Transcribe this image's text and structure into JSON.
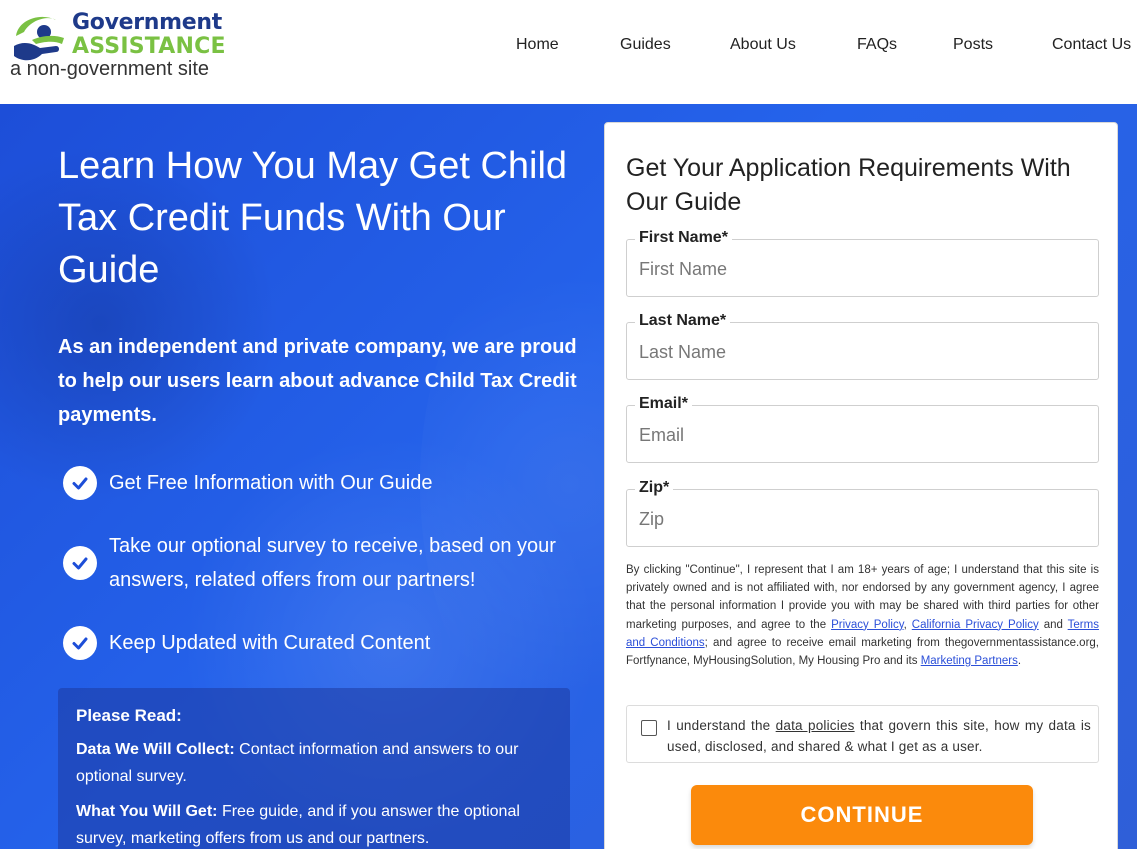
{
  "brand": {
    "line1": "Government",
    "line2": "ASSISTANCE",
    "tagline": "a non-government site",
    "colors": {
      "navy": "#1e3a8a",
      "green": "#7ac143"
    }
  },
  "nav": [
    "Home",
    "Guides",
    "About Us",
    "FAQs",
    "Posts",
    "Contact Us"
  ],
  "hero": {
    "title": "Learn How You May Get Child Tax Credit Funds With Our Guide",
    "subtitle": "As an independent and private company, we are proud to help our users learn about advance Child Tax Credit payments.",
    "features": [
      "Get Free Information with Our Guide",
      "Take our optional survey to receive, based on your answers, related offers from our partners!",
      "Keep Updated with Curated Content"
    ],
    "notice": {
      "heading": "Please Read:",
      "items": [
        {
          "label": "Data We Will Collect:",
          "text": "Contact information and answers to our optional survey."
        },
        {
          "label": "What You Will Get:",
          "text": "Free guide, and if you answer the optional survey, marketing offers from us and our partners."
        }
      ]
    },
    "bg_color": "#2563eb"
  },
  "form": {
    "title": "Get Your Application Requirements With Our Guide",
    "fields": [
      {
        "label": "First Name*",
        "placeholder": "First Name",
        "value": ""
      },
      {
        "label": "Last Name*",
        "placeholder": "Last Name",
        "value": ""
      },
      {
        "label": "Email*",
        "placeholder": "Email",
        "value": ""
      },
      {
        "label": "Zip*",
        "placeholder": "Zip",
        "value": ""
      }
    ],
    "legal": {
      "part1": "By clicking \"Continue\", I represent that I am 18+ years of age; I understand that this site is privately owned and is not affiliated with, nor endorsed by any government agency, I agree that the personal information I provide you with may be shared with third parties for other marketing purposes, and agree to the",
      "privacy": "Privacy Policy",
      "sep1": ",",
      "california": "California Privacy Policy",
      "and": "and",
      "terms": "Terms and Conditions",
      "part2": "; and agree to receive email marketing from thegovernmentassistance.org, Fortfynance, MyHousingSolution, My Housing Pro and its",
      "partners": "Marketing Partners",
      "end": "."
    },
    "consent": {
      "checked": false,
      "before": "I understand the",
      "link": "data policies",
      "after": "that govern this site, how my data is used, disclosed, and shared & what I get as a user."
    },
    "continue_label": "CONTINUE",
    "continue_color": "#fb8a0c"
  }
}
